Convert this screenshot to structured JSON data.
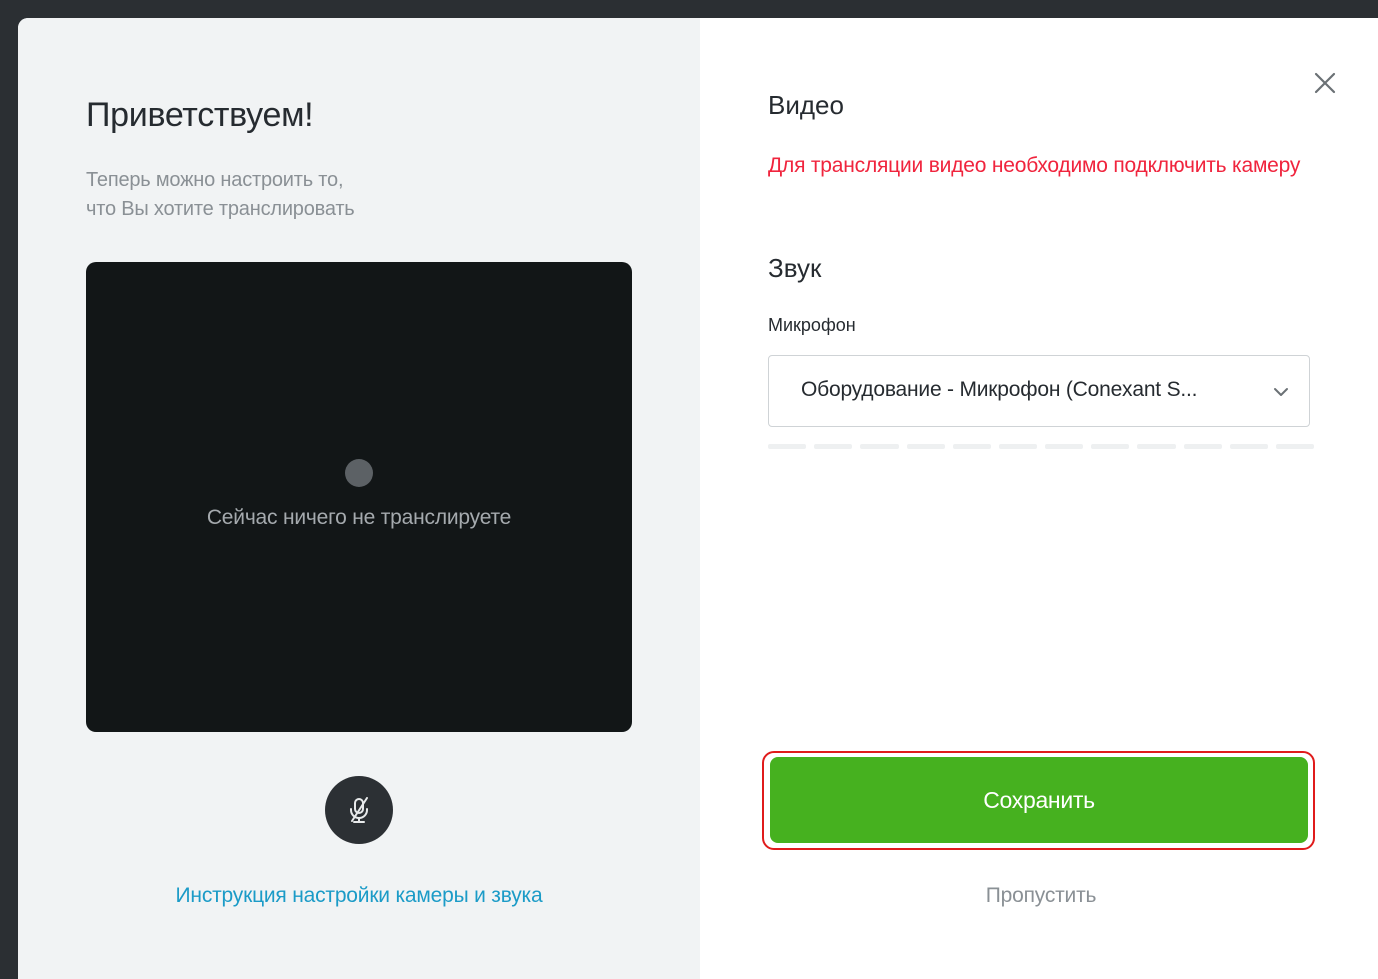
{
  "welcome": {
    "title": "Приветствуем!",
    "subtitle_line1": "Теперь можно настроить то,",
    "subtitle_line2": "что Вы хотите транслировать",
    "preview_text": "Сейчас ничего не транслируете",
    "mic_button_icon": "mic-off-icon",
    "help_link": "Инструкция настройки камеры и звука"
  },
  "settings": {
    "video_title": "Видео",
    "video_error": "Для трансляции видео необходимо подключить камеру",
    "sound_title": "Звук",
    "microphone_label": "Микрофон",
    "microphone_value": "Оборудование - Микрофон (Conexant S...",
    "level_segments": 12,
    "save_label": "Сохранить",
    "skip_label": "Пропустить"
  },
  "colors": {
    "accent_green": "#46b11f",
    "error_red": "#f0243d",
    "link_blue": "#1b9bc7",
    "highlight_outline": "#e01b1b"
  }
}
